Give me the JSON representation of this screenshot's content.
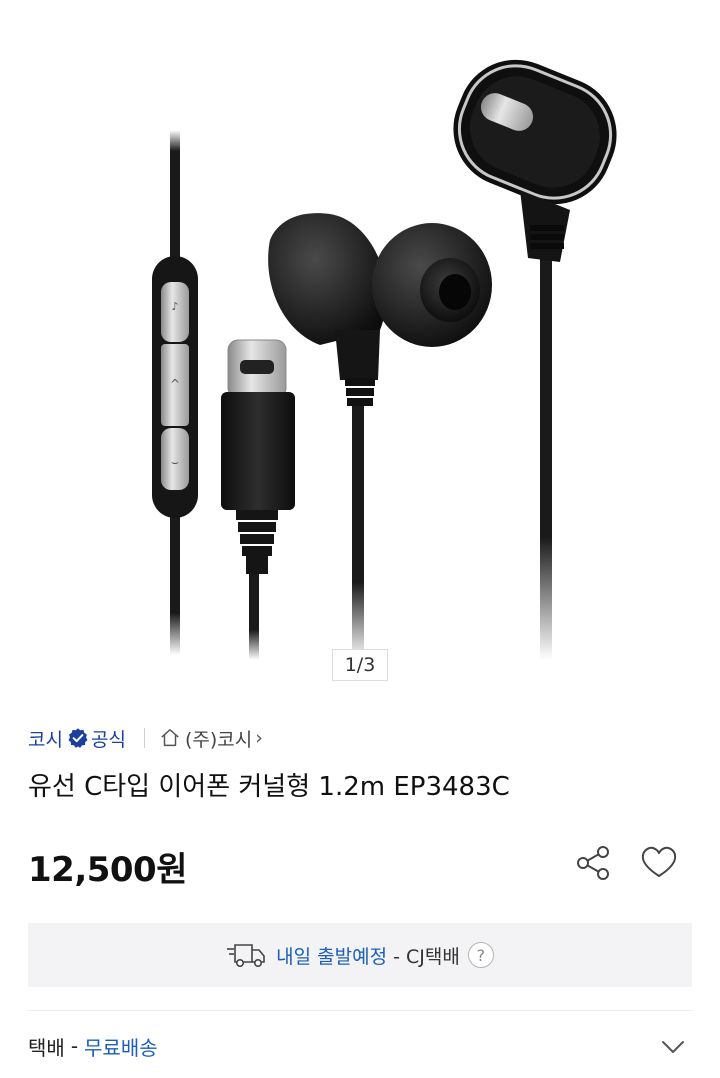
{
  "gallery": {
    "page_indicator": "1/3",
    "image_alt": "유선 C타입 이어폰"
  },
  "brand": {
    "name": "코시",
    "official_label": "공식",
    "store_label": "(주)코시",
    "store_chevron": "›"
  },
  "product": {
    "title": "유선 C타입 이어폰 커널형 1.2m EP3483C"
  },
  "price": {
    "amount": "12,500원"
  },
  "delivery": {
    "date_text": "내일 출발예정",
    "carrier_text": " - CJ택배",
    "help_glyph": "?"
  },
  "shipping": {
    "label": "택배",
    "dash": "-",
    "value": "무료배송"
  },
  "colors": {
    "brand_blue": "#1b3f9c",
    "link_blue": "#1b5fb8",
    "delivery_bg": "#f3f3f5"
  },
  "icons": {
    "verified": "verified-badge-icon",
    "store": "home-icon",
    "share": "share-icon",
    "wishlist": "heart-icon",
    "truck": "truck-icon",
    "help": "question-icon",
    "expand": "chevron-down-icon"
  }
}
